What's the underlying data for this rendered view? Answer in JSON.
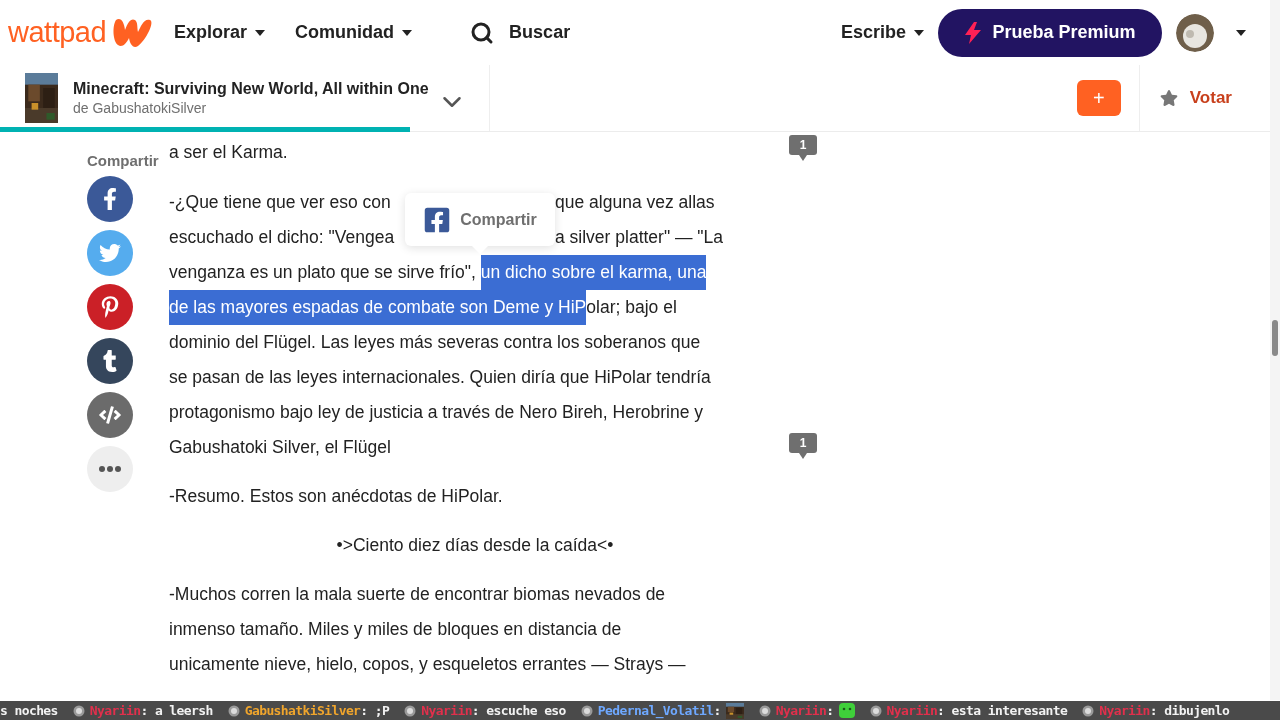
{
  "header": {
    "logo_text": "wattpad",
    "nav": [
      {
        "label": "Explorar"
      },
      {
        "label": "Comunidad"
      }
    ],
    "search": {
      "label": "Buscar"
    },
    "write": {
      "label": "Escribe"
    },
    "premium_button": {
      "label": "Prueba Premium"
    }
  },
  "story_bar": {
    "title": "Minecraft: Surviving New World, All within One",
    "author": "de GabushatokiSilver",
    "add_button": "+",
    "vote_label": "Votar",
    "progress": {
      "level": 0.32
    }
  },
  "share": {
    "label": "Compartir",
    "networks": [
      {
        "kind": "facebook"
      },
      {
        "kind": "twitter"
      },
      {
        "kind": "pinterest"
      },
      {
        "kind": "tumblr"
      },
      {
        "kind": "embed"
      },
      {
        "kind": "more"
      }
    ]
  },
  "tooltip": {
    "label": "Compartir"
  },
  "paragraphs": [
    {
      "kind": "text",
      "comments": "1",
      "lines": [
        {
          "covered": false,
          "segments": [
            {
              "text": "a ser el Karma.",
              "highlighted": false
            }
          ]
        }
      ]
    },
    {
      "kind": "text",
      "comments": "1",
      "lines": [
        {
          "covered": true,
          "segments": [
            {
              "text": "-¿Que tiene que ver eso con",
              "highlighted": false
            },
            {
              "text": "que alguna vez allas",
              "highlighted": false
            }
          ]
        },
        {
          "covered": true,
          "segments": [
            {
              "text": "escuchado el dicho: \"Vengea",
              "highlighted": false
            },
            {
              "text": "a silver platter\" — \"La",
              "highlighted": false
            }
          ]
        },
        {
          "covered": false,
          "segments": [
            {
              "text": "venganza es un plato que se sirve frío\", ",
              "highlighted": false
            },
            {
              "text": "un dicho sobre el karma, una",
              "highlighted": true
            }
          ]
        },
        {
          "covered": false,
          "segments": [
            {
              "text": "de las mayores espadas de combate son Deme y HiP",
              "highlighted": true
            },
            {
              "text": "olar; bajo el",
              "highlighted": false
            }
          ]
        },
        {
          "covered": false,
          "segments": [
            {
              "text": "dominio del Flügel. Las leyes más severas contra los soberanos que",
              "highlighted": false
            }
          ]
        },
        {
          "covered": false,
          "segments": [
            {
              "text": "se pasan de las leyes internacionales. Quien diría que HiPolar tendría",
              "highlighted": false
            }
          ]
        },
        {
          "covered": false,
          "segments": [
            {
              "text": "protagonismo bajo ley de justicia a través de Nero Bireh, Herobrine y",
              "highlighted": false
            }
          ]
        },
        {
          "covered": false,
          "segments": [
            {
              "text": "Gabushatoki Silver, el Flügel",
              "highlighted": false
            }
          ]
        }
      ]
    },
    {
      "kind": "text",
      "lines": [
        {
          "covered": false,
          "segments": [
            {
              "text": "-Resumo. Estos son anécdotas de HiPolar.",
              "highlighted": false
            }
          ]
        }
      ]
    },
    {
      "kind": "heading",
      "lines": [
        {
          "covered": false,
          "segments": [
            {
              "text": "•>Ciento diez días desde la caída<•",
              "highlighted": false
            }
          ]
        }
      ]
    },
    {
      "kind": "text",
      "lines": [
        {
          "covered": false,
          "segments": [
            {
              "text": "-Muchos corren la mala suerte de encontrar biomas nevados de",
              "highlighted": false
            }
          ]
        },
        {
          "covered": false,
          "segments": [
            {
              "text": "inmenso tamaño. Miles y miles de bloques en distancia de",
              "highlighted": false
            }
          ]
        },
        {
          "covered": false,
          "segments": [
            {
              "text": "unicamente nieve, hielo, copos, y esqueletos errantes — Strays —",
              "highlighted": false
            }
          ]
        }
      ]
    }
  ],
  "chat": [
    {
      "kind": "text",
      "text": "s noches"
    },
    {
      "kind": "text",
      "user": "Nyariin",
      "color": "#e0304c",
      "text": ": a leersh"
    },
    {
      "kind": "text",
      "user": "GabushatkiSilver",
      "color": "#f0a52c",
      "text": ": ;P"
    },
    {
      "kind": "text",
      "user": "Nyariin",
      "color": "#e0304c",
      "text": ": escuche eso"
    },
    {
      "kind": "picture",
      "user": "Pedernal_Volatil",
      "color": "#6ea8ff",
      "text": ":"
    },
    {
      "kind": "emoji",
      "user": "Nyariin",
      "color": "#e0304c",
      "text": ":"
    },
    {
      "kind": "text",
      "user": "Nyariin",
      "color": "#e0304c",
      "text": ": esta interesante"
    },
    {
      "kind": "text",
      "user": "Nyariin",
      "color": "#e0304c",
      "text": ": dibujenlo"
    }
  ]
}
